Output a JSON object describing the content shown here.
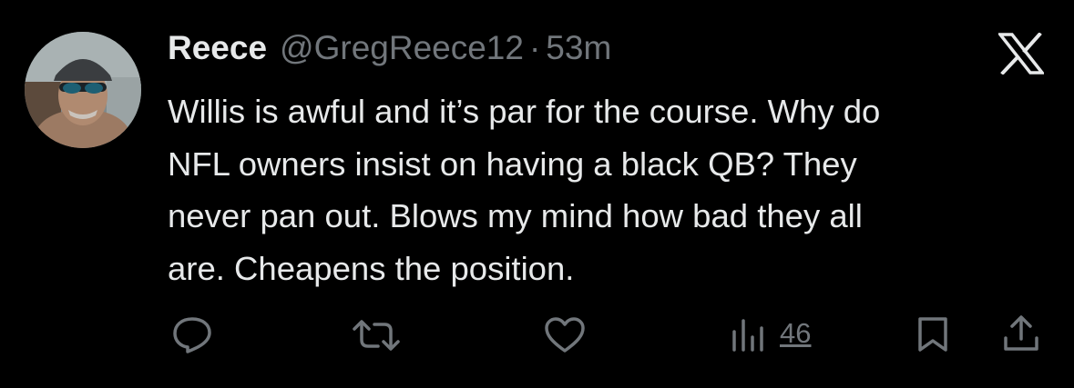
{
  "tweet": {
    "author_name": "Reece",
    "author_handle": "@GregReece12",
    "separator": "·",
    "timestamp": "53m",
    "text": "Willis is awful and it’s par for the course. Why do\nNFL owners insist on having a black QB? They\nnever pan out. Blows my mind how bad they all\nare. Cheapens the position."
  },
  "actions": {
    "reply_icon": "reply-icon",
    "retweet_icon": "retweet-icon",
    "like_icon": "heart-icon",
    "views_icon": "views-chart-icon",
    "views_count": "46",
    "bookmark_icon": "bookmark-icon",
    "share_icon": "share-icon"
  },
  "brand": {
    "logo": "x-logo-icon"
  },
  "colors": {
    "background": "#000000",
    "primary_text": "#e7e9ea",
    "secondary_text": "#71767b"
  }
}
